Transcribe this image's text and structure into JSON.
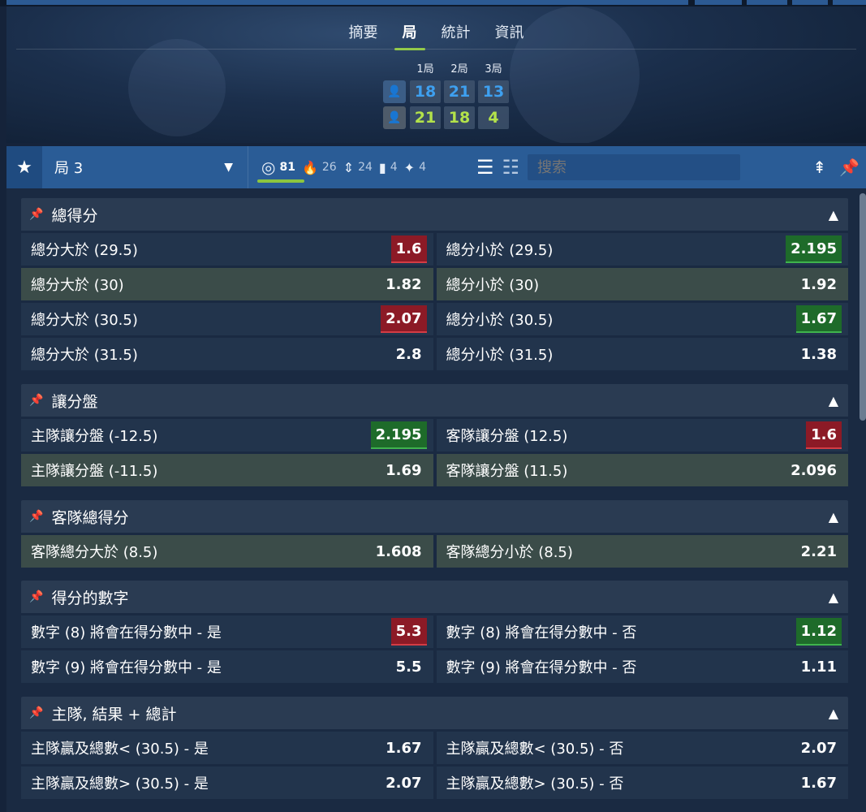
{
  "tabs": [
    {
      "label": "摘要",
      "active": false
    },
    {
      "label": "局",
      "active": true
    },
    {
      "label": "統計",
      "active": false
    },
    {
      "label": "資訊",
      "active": false
    }
  ],
  "scoreboard": {
    "set_headers": [
      "1局",
      "2局",
      "3局"
    ],
    "home_scores": [
      "18",
      "21",
      "13"
    ],
    "away_scores": [
      "21",
      "18",
      "4"
    ]
  },
  "filter": {
    "selected": "局 3",
    "counters": [
      "81",
      "26",
      "24",
      "4",
      "4"
    ],
    "search_placeholder": "搜索"
  },
  "sections": [
    {
      "title": "總得分",
      "rows": [
        [
          {
            "label": "總分大於 (29.5)",
            "odd": "1.6",
            "trend": "down"
          },
          {
            "label": "總分小於 (29.5)",
            "odd": "2.195",
            "trend": "up"
          }
        ],
        [
          {
            "label": "總分大於 (30)",
            "odd": "1.82",
            "trend": "",
            "hl": true
          },
          {
            "label": "總分小於 (30)",
            "odd": "1.92",
            "trend": "",
            "hl": true
          }
        ],
        [
          {
            "label": "總分大於 (30.5)",
            "odd": "2.07",
            "trend": "down"
          },
          {
            "label": "總分小於 (30.5)",
            "odd": "1.67",
            "trend": "up"
          }
        ],
        [
          {
            "label": "總分大於 (31.5)",
            "odd": "2.8",
            "trend": ""
          },
          {
            "label": "總分小於 (31.5)",
            "odd": "1.38",
            "trend": ""
          }
        ]
      ]
    },
    {
      "title": "讓分盤",
      "rows": [
        [
          {
            "label": "主隊讓分盤 (-12.5)",
            "odd": "2.195",
            "trend": "up"
          },
          {
            "label": "客隊讓分盤 (12.5)",
            "odd": "1.6",
            "trend": "down"
          }
        ],
        [
          {
            "label": "主隊讓分盤 (-11.5)",
            "odd": "1.69",
            "trend": "",
            "hl": true
          },
          {
            "label": "客隊讓分盤 (11.5)",
            "odd": "2.096",
            "trend": "",
            "hl": true
          }
        ]
      ]
    },
    {
      "title": "客隊總得分",
      "rows": [
        [
          {
            "label": "客隊總分大於 (8.5)",
            "odd": "1.608",
            "trend": "",
            "hl": true
          },
          {
            "label": "客隊總分小於 (8.5)",
            "odd": "2.21",
            "trend": "",
            "hl": true
          }
        ]
      ]
    },
    {
      "title": "得分的數字",
      "rows": [
        [
          {
            "label": "數字 (8) 將會在得分數中 - 是",
            "odd": "5.3",
            "trend": "down"
          },
          {
            "label": "數字 (8) 將會在得分數中 - 否",
            "odd": "1.12",
            "trend": "up"
          }
        ],
        [
          {
            "label": "數字 (9) 將會在得分數中 - 是",
            "odd": "5.5",
            "trend": ""
          },
          {
            "label": "數字 (9) 將會在得分數中 - 否",
            "odd": "1.11",
            "trend": ""
          }
        ]
      ]
    },
    {
      "title": "主隊, 結果 + 總計",
      "rows": [
        [
          {
            "label": "主隊贏及總數< (30.5) - 是",
            "odd": "1.67",
            "trend": ""
          },
          {
            "label": "主隊贏及總數< (30.5) - 否",
            "odd": "2.07",
            "trend": ""
          }
        ],
        [
          {
            "label": "主隊贏及總數> (30.5) - 是",
            "odd": "2.07",
            "trend": ""
          },
          {
            "label": "主隊贏及總數> (30.5) - 否",
            "odd": "1.67",
            "trend": ""
          }
        ]
      ]
    }
  ]
}
